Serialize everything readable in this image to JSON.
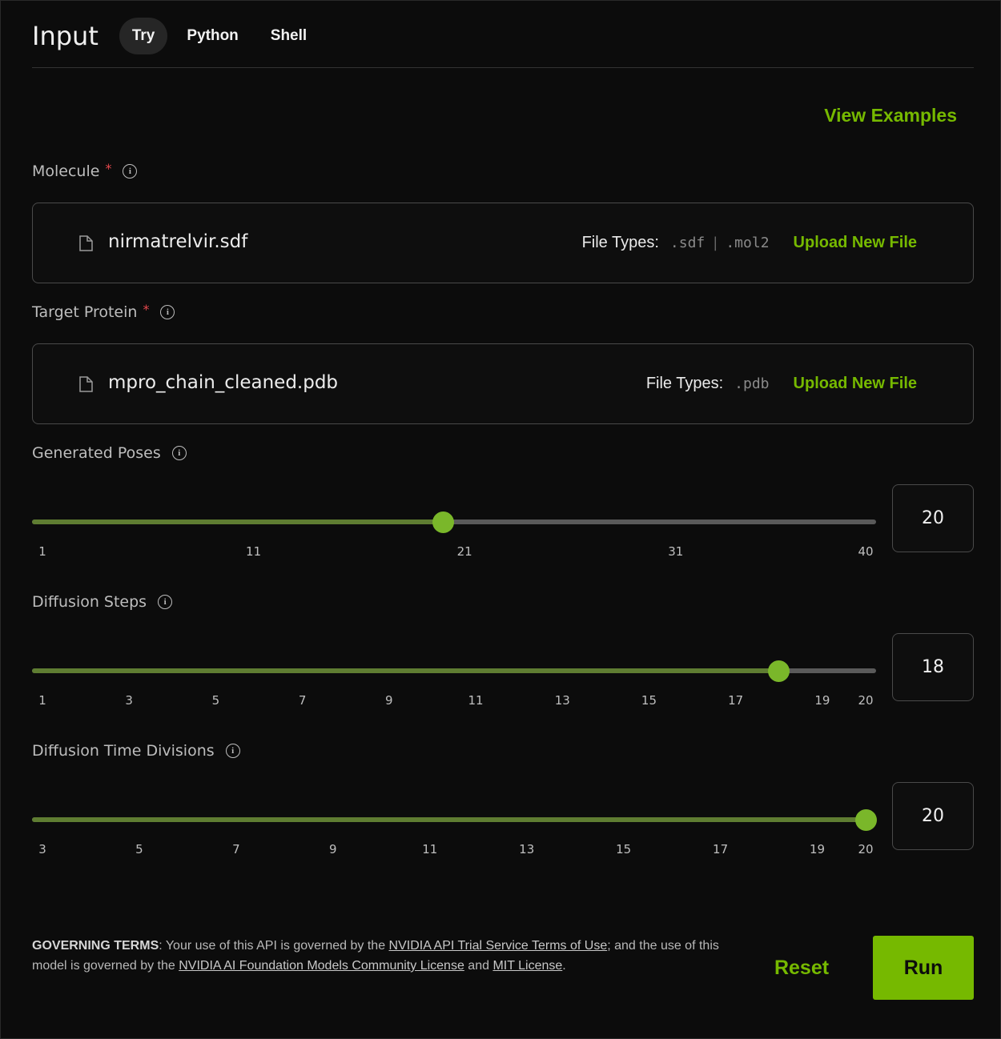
{
  "header": {
    "title": "Input",
    "tabs": [
      {
        "label": "Try",
        "active": true
      },
      {
        "label": "Python",
        "active": false
      },
      {
        "label": "Shell",
        "active": false
      }
    ]
  },
  "view_examples_label": "View Examples",
  "molecule": {
    "label": "Molecule",
    "required_mark": "*",
    "file_name": "nirmatrelvir.sdf",
    "file_types_label": "File Types:",
    "file_types": [
      ".sdf",
      ".mol2"
    ],
    "file_types_separator": "|",
    "upload_label": "Upload New File"
  },
  "target_protein": {
    "label": "Target Protein",
    "required_mark": "*",
    "file_name": "mpro_chain_cleaned.pdb",
    "file_types_label": "File Types:",
    "file_types": [
      ".pdb"
    ],
    "upload_label": "Upload New File"
  },
  "sliders": [
    {
      "label": "Generated Poses",
      "min": 1,
      "max": 40,
      "value": 20,
      "display": "20",
      "ticks": [
        "1",
        "11",
        "21",
        "31",
        "40"
      ]
    },
    {
      "label": "Diffusion Steps",
      "min": 1,
      "max": 20,
      "value": 18,
      "display": "18",
      "ticks": [
        "1",
        "3",
        "5",
        "7",
        "9",
        "11",
        "13",
        "15",
        "17",
        "19",
        "20"
      ]
    },
    {
      "label": "Diffusion Time Divisions",
      "min": 3,
      "max": 20,
      "value": 20,
      "display": "20",
      "ticks": [
        "3",
        "5",
        "7",
        "9",
        "11",
        "13",
        "15",
        "17",
        "19",
        "20"
      ]
    }
  ],
  "terms": {
    "heading": "GOVERNING TERMS",
    "text1": ": Your use of this API is governed by the ",
    "link1": "NVIDIA API Trial Service Terms of Use",
    "text2": "; and the use of this model is governed by the ",
    "link2": "NVIDIA AI Foundation Models Community License",
    "text3": " and ",
    "link3": "MIT License",
    "text4": "."
  },
  "actions": {
    "reset_label": "Reset",
    "run_label": "Run"
  },
  "colors": {
    "accent": "#76b900",
    "required": "#e5484d"
  }
}
